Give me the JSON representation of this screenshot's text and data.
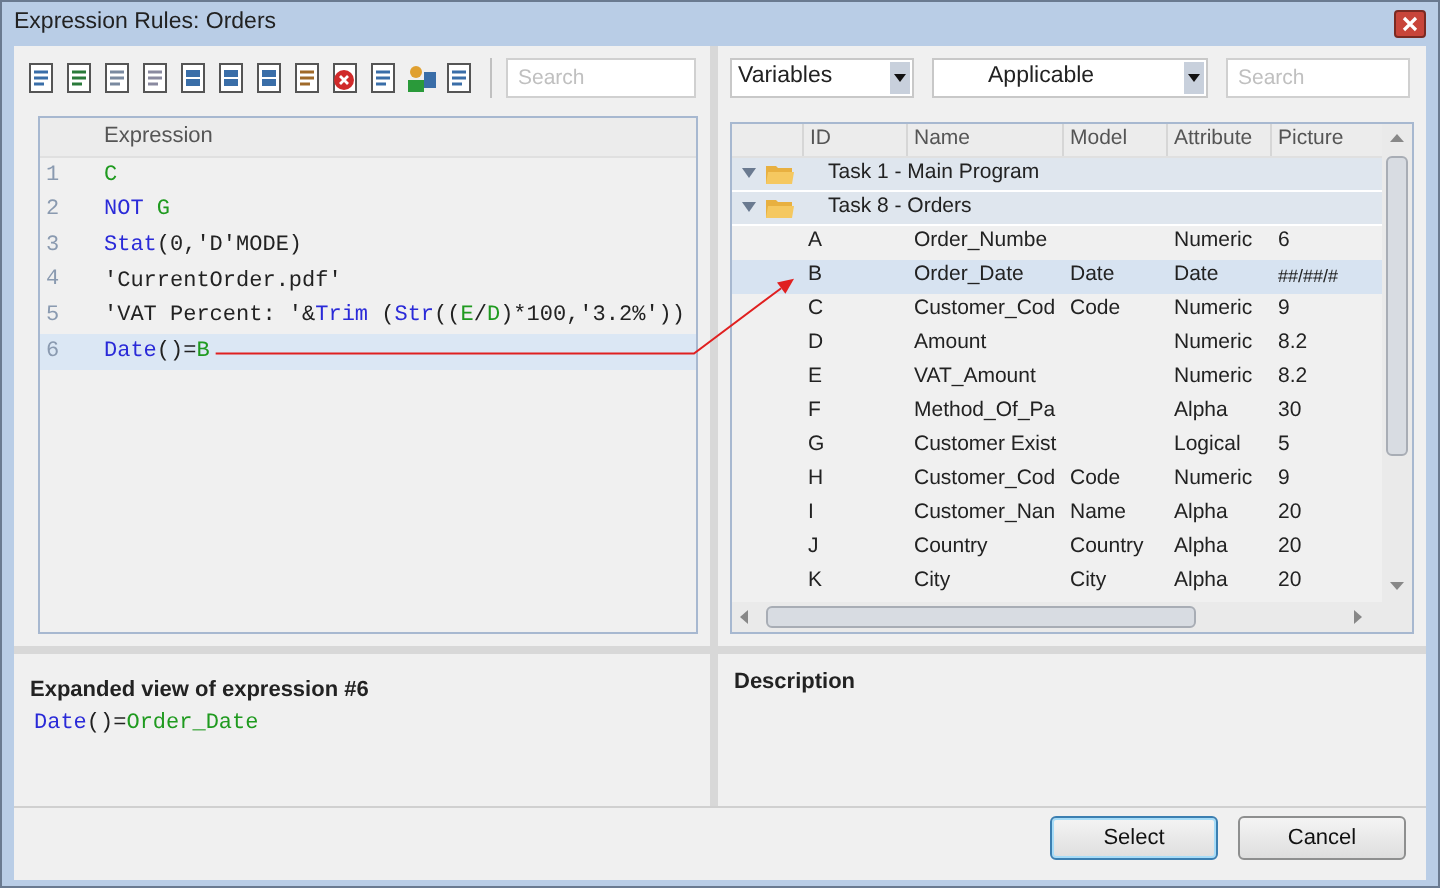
{
  "window": {
    "title": "Expression Rules: Orders"
  },
  "toolbar": {
    "search": {
      "placeholder": "Search"
    }
  },
  "editor": {
    "column": "Expression",
    "lines": [
      {
        "number": "1",
        "selected": false,
        "tokens": [
          {
            "text": "C",
            "kind": "var"
          }
        ]
      },
      {
        "number": "2",
        "selected": false,
        "tokens": [
          {
            "text": "NOT",
            "kind": "keyword"
          },
          {
            "text": "G",
            "kind": "var",
            "space_before": true
          }
        ]
      },
      {
        "number": "3",
        "selected": false,
        "tokens": [
          {
            "text": "Stat",
            "kind": "keyword"
          },
          {
            "text": "(0,'D'MODE)",
            "kind": "plain"
          }
        ]
      },
      {
        "number": "4",
        "selected": false,
        "tokens": [
          {
            "text": "'CurrentOrder.pdf'",
            "kind": "plain"
          }
        ]
      },
      {
        "number": "5",
        "selected": false,
        "tokens": [
          {
            "text": "'VAT Percent: '&",
            "kind": "plain"
          },
          {
            "text": "Trim",
            "kind": "keyword"
          },
          {
            "text": " (",
            "kind": "plain"
          },
          {
            "text": "Str",
            "kind": "keyword"
          },
          {
            "text": "((",
            "kind": "plain"
          },
          {
            "text": "E",
            "kind": "var"
          },
          {
            "text": "/",
            "kind": "plain"
          },
          {
            "text": "D",
            "kind": "var"
          },
          {
            "text": ")*100,'3.2%'))",
            "kind": "plain"
          }
        ]
      },
      {
        "number": "6",
        "selected": true,
        "tokens": [
          {
            "text": "Date",
            "kind": "keyword"
          },
          {
            "text": "()=",
            "kind": "plain"
          },
          {
            "text": "B",
            "kind": "var"
          }
        ]
      }
    ]
  },
  "variables": {
    "source": "Variables",
    "filter": "Applicable",
    "search": {
      "placeholder": "Search"
    },
    "columns": [
      "ID",
      "Name",
      "Model",
      "Attribute",
      "Picture"
    ],
    "groups": [
      {
        "label": "Task  1 - Main Program",
        "expanded": true
      },
      {
        "label": "Task  8 - Orders",
        "expanded": true,
        "children": [
          {
            "id": "A",
            "name": "Order_Numbe",
            "attribute": "Numeric",
            "picture": "6",
            "selected": false
          },
          {
            "id": "B",
            "name": "Order_Date",
            "model": "Date",
            "attribute": "Date",
            "picture": "##/##/#",
            "selected": true
          },
          {
            "id": "C",
            "name": "Customer_Cod",
            "model": "Code",
            "attribute": "Numeric",
            "picture": "9",
            "selected": false
          },
          {
            "id": "D",
            "name": "Amount",
            "attribute": "Numeric",
            "picture": "8.2",
            "selected": false
          },
          {
            "id": "E",
            "name": "VAT_Amount",
            "attribute": "Numeric",
            "picture": "8.2",
            "selected": false
          },
          {
            "id": "F",
            "name": "Method_Of_Pa",
            "attribute": "Alpha",
            "picture": "30",
            "selected": false
          },
          {
            "id": "G",
            "name": "Customer Exist",
            "attribute": "Logical",
            "picture": "5",
            "selected": false
          },
          {
            "id": "H",
            "name": "Customer_Cod",
            "model": "Code",
            "attribute": "Numeric",
            "picture": "9",
            "selected": false
          },
          {
            "id": "I",
            "name": "Customer_Nan",
            "model": "Name",
            "attribute": "Alpha",
            "picture": "20",
            "selected": false
          },
          {
            "id": "J",
            "name": "Country",
            "model": "Country",
            "attribute": "Alpha",
            "picture": "20",
            "selected": false
          },
          {
            "id": "K",
            "name": "City",
            "model": "City",
            "attribute": "Alpha",
            "picture": "20",
            "selected": false
          }
        ]
      }
    ]
  },
  "expanded_view": {
    "title": "Expanded view of expression #6",
    "tokens": [
      {
        "text": "Date",
        "kind": "keyword"
      },
      {
        "text": "()=",
        "kind": "plain"
      },
      {
        "text": "Order_Date",
        "kind": "var"
      }
    ]
  },
  "description": {
    "title": "Description"
  },
  "buttons": [
    {
      "label": "Select",
      "default": true
    },
    {
      "label": "Cancel",
      "default": false
    }
  ]
}
